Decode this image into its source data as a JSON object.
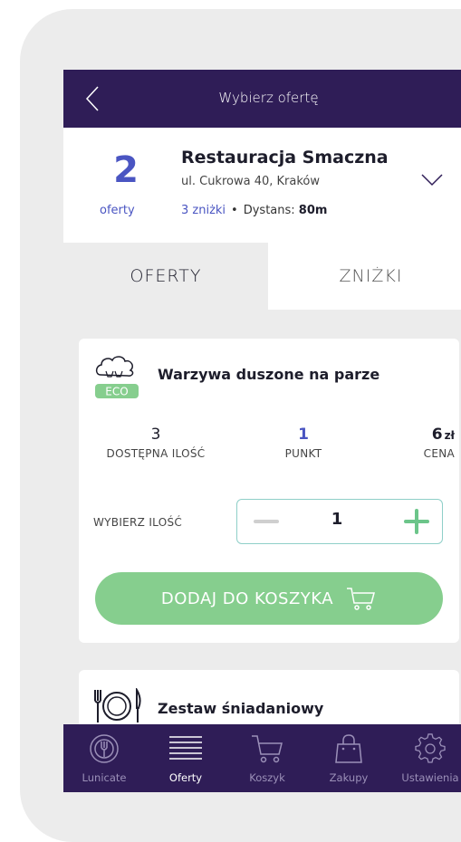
{
  "header": {
    "title": "Wybierz ofertę",
    "back_icon": "chevron-left-icon"
  },
  "restaurant": {
    "offers_count": "2",
    "offers_label": "oferty",
    "name": "Restauracja Smaczna",
    "address": "ul. Cukrowa 40, Kraków",
    "discounts": "3 zniżki",
    "separator": "•",
    "distance_label": "Dystans:",
    "distance_value": "80m"
  },
  "tabs": [
    {
      "label": "OFERTY",
      "active": true
    },
    {
      "label": "ZNIŻKI",
      "active": false
    }
  ],
  "offer": {
    "badge": "ECO",
    "title": "Warzywa duszone na parze",
    "quantity_value": "3",
    "quantity_label": "DOSTĘPNA ILOŚĆ",
    "points_value": "1",
    "points_label": "PUNKT",
    "price_value": "6",
    "price_currency": "zł",
    "price_label": "CENA",
    "choose_label": "WYBIERZ ILOŚĆ",
    "selected_quantity": "1",
    "add_button": "DODAJ DO KOSZYKA"
  },
  "offer2": {
    "title": "Zestaw śniadaniowy"
  },
  "bottom_nav": [
    {
      "label": "Lunicate",
      "icon": "plate-logo-icon",
      "active": false
    },
    {
      "label": "Oferty",
      "icon": "list-icon",
      "active": true
    },
    {
      "label": "Koszyk",
      "icon": "cart-icon",
      "active": false
    },
    {
      "label": "Zakupy",
      "icon": "bag-icon",
      "active": false
    },
    {
      "label": "Ustawienia",
      "icon": "gear-icon",
      "active": false
    }
  ],
  "colors": {
    "primary": "#2f1d57",
    "accent_blue": "#4a55c2",
    "green": "#86ce8e",
    "background": "#ececec"
  }
}
